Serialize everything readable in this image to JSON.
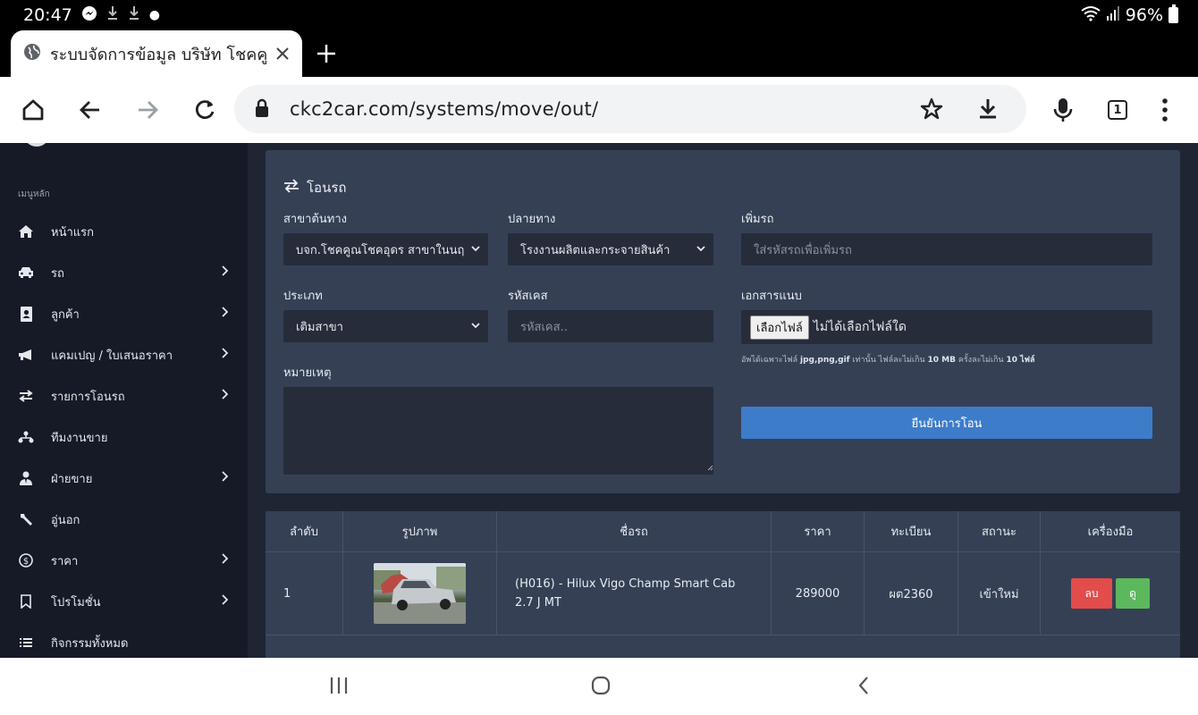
{
  "status_bar": {
    "time": "20:47",
    "battery": "96%"
  },
  "browser": {
    "tab_title": "ระบบจัดการข้อมูล บริษัท โชคคูณ",
    "url": "ckc2car.com/systems/move/out/",
    "tab_count": "1"
  },
  "sidebar": {
    "heading": "เมนูหลัก",
    "items": [
      {
        "label": "หน้าแรก",
        "icon": "home-icon"
      },
      {
        "label": "รถ",
        "icon": "car-icon"
      },
      {
        "label": "ลูกค้า",
        "icon": "contact-book-icon"
      },
      {
        "label": "แคมเปญ / ใบเสนอราคา",
        "icon": "megaphone-icon"
      },
      {
        "label": "รายการโอนรถ",
        "icon": "transfer-icon"
      },
      {
        "label": "ทีมงานขาย",
        "icon": "sitemap-icon"
      },
      {
        "label": "ฝ่ายขาย",
        "icon": "user-tie-icon"
      },
      {
        "label": "อู่นอก",
        "icon": "wrench-icon"
      },
      {
        "label": "ราคา",
        "icon": "dollar-icon"
      },
      {
        "label": "โปรโมชั่น",
        "icon": "bookmark-icon"
      },
      {
        "label": "กิจกรรมทั้งหมด",
        "icon": "list-icon"
      }
    ]
  },
  "form": {
    "title": "โอนรถ",
    "source_label": "สาขาต้นทาง",
    "source_value": "บจก.โชคคูณโชคอุดร สาขาในนฤ",
    "dest_label": "ปลายทาง",
    "dest_value": "โรงงานผลิตและกระจายสินค้า",
    "add_car_label": "เพิ่มรถ",
    "add_car_placeholder": "ใส่รหัสรถเพื่อเพิ่มรถ",
    "type_label": "ประเภท",
    "type_value": "เติมสาขา",
    "case_label": "รหัสเคส",
    "case_placeholder": "รหัสเคส..",
    "attach_label": "เอกสารแนบ",
    "file_button": "เลือกไฟล์",
    "file_status": "ไม่ได้เลือกไฟล์ใด",
    "hint_prefix": "อัพได้เฉพาะไฟล์",
    "hint_types": "jpg,png,gif",
    "hint_mid": "เท่านั้น ไฟล์ละไม่เกิน",
    "hint_size": "10 MB",
    "hint_mid2": "ครั้งละไม่เกิน",
    "hint_count": "10 ไฟล์",
    "note_label": "หมายเหตุ",
    "confirm_button": "ยืนยันการโอน"
  },
  "table": {
    "headers": [
      "ลำดับ",
      "รูปภาพ",
      "ชื่อรถ",
      "ราคา",
      "ทะเบียน",
      "สถานะ",
      "เครื่องมือ"
    ],
    "rows": [
      {
        "no": "1",
        "name": "(H016) - Hilux Vigo Champ Smart Cab 2.7 J MT",
        "price": "289000",
        "plate": "ผต2360",
        "status": "เข้าใหม่",
        "delete": "ลบ",
        "view": "ดู"
      }
    ]
  }
}
